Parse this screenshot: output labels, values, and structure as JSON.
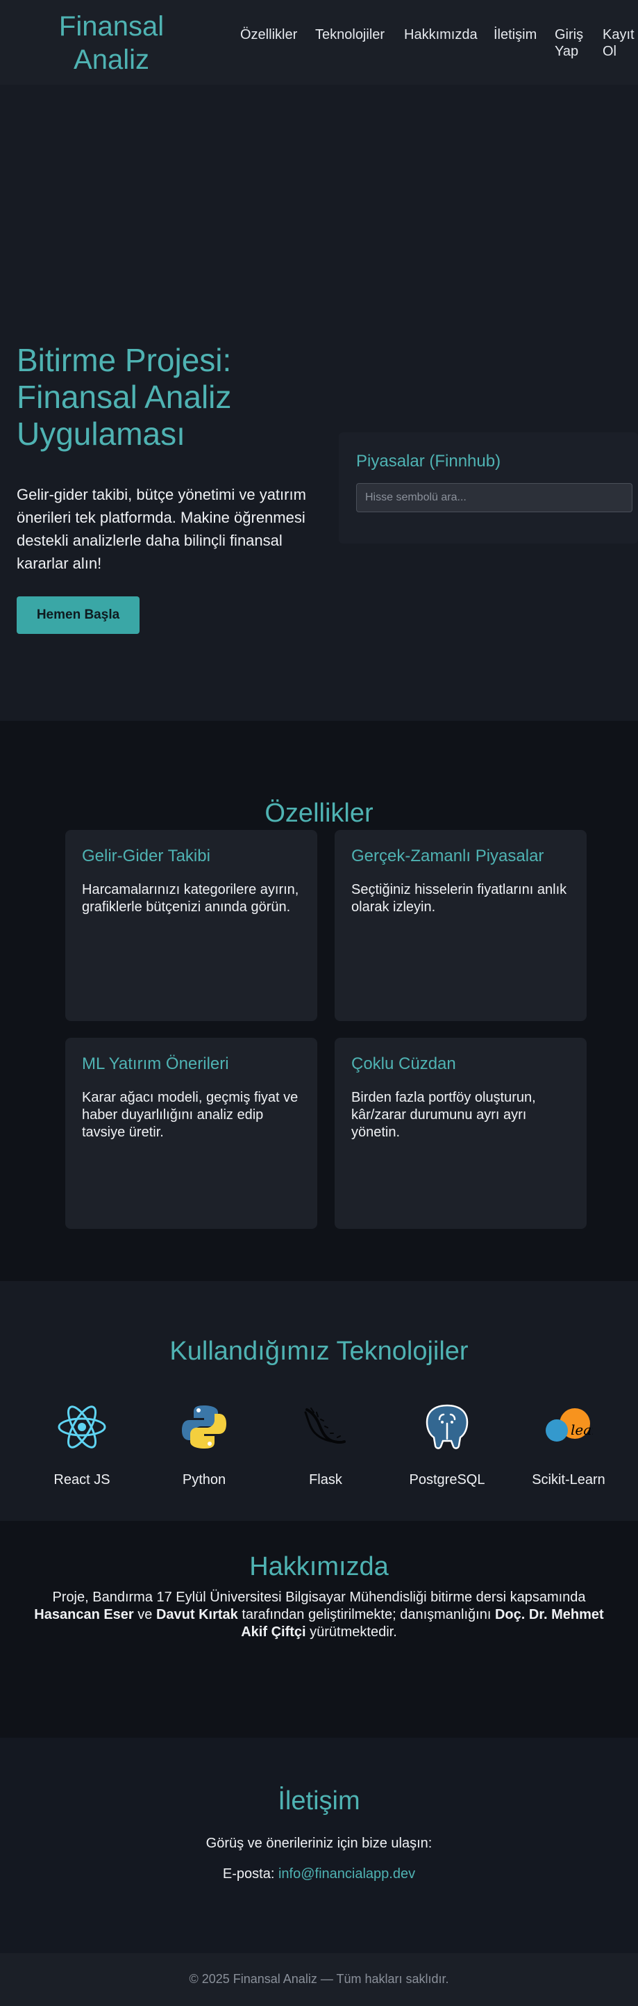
{
  "nav": {
    "brand": "Finansal Analiz",
    "links": [
      "Özellikler",
      "Teknolojiler",
      "Hakkımızda",
      "İletişim",
      "Giriş Yap",
      "Kayıt Ol"
    ]
  },
  "hero": {
    "title": "Bitirme Projesi: Finansal Analiz Uygulaması",
    "lead": "Gelir-gider takibi, bütçe yönetimi ve yatırım önerileri tek platformda. Makine öğrenmesi destekli analizlerle daha bilinçli finansal kararlar alın!",
    "cta_label": "Hemen Başla",
    "market": {
      "title": "Piyasalar (Finnhub)",
      "search_placeholder": "Hisse sembolü ara..."
    }
  },
  "features": {
    "title": "Özellikler",
    "items": [
      {
        "title": "Gelir-Gider Takibi",
        "desc": "Harcamalarınızı kategorilere ayırın, grafiklerle bütçenizi anında görün."
      },
      {
        "title": "Gerçek-Zamanlı Piyasalar",
        "desc": "Seçtiğiniz hisselerin fiyatlarını anlık olarak izleyin."
      },
      {
        "title": "ML Yatırım Önerileri",
        "desc": "Karar ağacı modeli, geçmiş fiyat ve haber duyarlılığını analiz edip tavsiye üretir."
      },
      {
        "title": "Çoklu Cüzdan",
        "desc": "Birden fazla portföy oluşturun, kâr/zarar durumunu ayrı ayrı yönetin."
      }
    ]
  },
  "tech": {
    "title": "Kullandığımız Teknolojiler",
    "items": [
      {
        "label": "React JS",
        "icon": "react-icon"
      },
      {
        "label": "Python",
        "icon": "python-icon"
      },
      {
        "label": "Flask",
        "icon": "flask-icon"
      },
      {
        "label": "PostgreSQL",
        "icon": "postgresql-icon"
      },
      {
        "label": "Scikit-Learn",
        "icon": "scikit-learn-icon"
      }
    ]
  },
  "about": {
    "title": "Hakkımızda",
    "text_1": "Proje, Bandırma 17 Eylül Üniversitesi Bilgisayar Mühendisliği bitirme dersi kapsamında",
    "name_1": "Hasancan Eser",
    "text_2": "ve",
    "name_2": "Davut Kırtak",
    "text_3": "tarafından geliştirilmekte; danışmanlığını",
    "advisor": "Doç. Dr. Mehmet Akif Çiftçi",
    "text_4": "yürütmektedir."
  },
  "contact": {
    "title": "İletişim",
    "subtitle": "Görüş ve önerileriniz için bize ulaşın:",
    "email_label": "E-posta:",
    "email": "info@financialapp.dev"
  },
  "footer": {
    "text": "© 2025 Finansal Analiz — Tüm hakları saklıdır."
  },
  "colors": {
    "accent": "#4fb3b3",
    "cta": "#3aa7a6",
    "background": "#141821"
  }
}
